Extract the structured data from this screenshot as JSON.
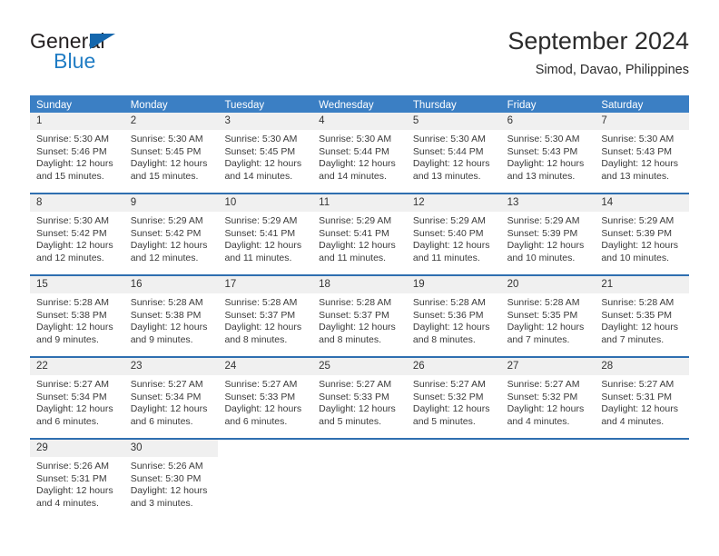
{
  "brand": {
    "line1": "General",
    "line2": "Blue",
    "flag_icon": "triangle-flag-icon",
    "accent_color": "#1f7cc4"
  },
  "header": {
    "title": "September 2024",
    "subtitle": "Simod, Davao, Philippines"
  },
  "theme": {
    "header_bar_color": "#3b7fc4",
    "row_divider_color": "#2f6fb0",
    "day_number_band_color": "#f0f0f0",
    "text_color": "#3a3a3a"
  },
  "weekdays": [
    "Sunday",
    "Monday",
    "Tuesday",
    "Wednesday",
    "Thursday",
    "Friday",
    "Saturday"
  ],
  "weeks": [
    [
      {
        "day": "1",
        "sunrise": "Sunrise: 5:30 AM",
        "sunset": "Sunset: 5:46 PM",
        "daylight": "Daylight: 12 hours and 15 minutes."
      },
      {
        "day": "2",
        "sunrise": "Sunrise: 5:30 AM",
        "sunset": "Sunset: 5:45 PM",
        "daylight": "Daylight: 12 hours and 15 minutes."
      },
      {
        "day": "3",
        "sunrise": "Sunrise: 5:30 AM",
        "sunset": "Sunset: 5:45 PM",
        "daylight": "Daylight: 12 hours and 14 minutes."
      },
      {
        "day": "4",
        "sunrise": "Sunrise: 5:30 AM",
        "sunset": "Sunset: 5:44 PM",
        "daylight": "Daylight: 12 hours and 14 minutes."
      },
      {
        "day": "5",
        "sunrise": "Sunrise: 5:30 AM",
        "sunset": "Sunset: 5:44 PM",
        "daylight": "Daylight: 12 hours and 13 minutes."
      },
      {
        "day": "6",
        "sunrise": "Sunrise: 5:30 AM",
        "sunset": "Sunset: 5:43 PM",
        "daylight": "Daylight: 12 hours and 13 minutes."
      },
      {
        "day": "7",
        "sunrise": "Sunrise: 5:30 AM",
        "sunset": "Sunset: 5:43 PM",
        "daylight": "Daylight: 12 hours and 13 minutes."
      }
    ],
    [
      {
        "day": "8",
        "sunrise": "Sunrise: 5:30 AM",
        "sunset": "Sunset: 5:42 PM",
        "daylight": "Daylight: 12 hours and 12 minutes."
      },
      {
        "day": "9",
        "sunrise": "Sunrise: 5:29 AM",
        "sunset": "Sunset: 5:42 PM",
        "daylight": "Daylight: 12 hours and 12 minutes."
      },
      {
        "day": "10",
        "sunrise": "Sunrise: 5:29 AM",
        "sunset": "Sunset: 5:41 PM",
        "daylight": "Daylight: 12 hours and 11 minutes."
      },
      {
        "day": "11",
        "sunrise": "Sunrise: 5:29 AM",
        "sunset": "Sunset: 5:41 PM",
        "daylight": "Daylight: 12 hours and 11 minutes."
      },
      {
        "day": "12",
        "sunrise": "Sunrise: 5:29 AM",
        "sunset": "Sunset: 5:40 PM",
        "daylight": "Daylight: 12 hours and 11 minutes."
      },
      {
        "day": "13",
        "sunrise": "Sunrise: 5:29 AM",
        "sunset": "Sunset: 5:39 PM",
        "daylight": "Daylight: 12 hours and 10 minutes."
      },
      {
        "day": "14",
        "sunrise": "Sunrise: 5:29 AM",
        "sunset": "Sunset: 5:39 PM",
        "daylight": "Daylight: 12 hours and 10 minutes."
      }
    ],
    [
      {
        "day": "15",
        "sunrise": "Sunrise: 5:28 AM",
        "sunset": "Sunset: 5:38 PM",
        "daylight": "Daylight: 12 hours and 9 minutes."
      },
      {
        "day": "16",
        "sunrise": "Sunrise: 5:28 AM",
        "sunset": "Sunset: 5:38 PM",
        "daylight": "Daylight: 12 hours and 9 minutes."
      },
      {
        "day": "17",
        "sunrise": "Sunrise: 5:28 AM",
        "sunset": "Sunset: 5:37 PM",
        "daylight": "Daylight: 12 hours and 8 minutes."
      },
      {
        "day": "18",
        "sunrise": "Sunrise: 5:28 AM",
        "sunset": "Sunset: 5:37 PM",
        "daylight": "Daylight: 12 hours and 8 minutes."
      },
      {
        "day": "19",
        "sunrise": "Sunrise: 5:28 AM",
        "sunset": "Sunset: 5:36 PM",
        "daylight": "Daylight: 12 hours and 8 minutes."
      },
      {
        "day": "20",
        "sunrise": "Sunrise: 5:28 AM",
        "sunset": "Sunset: 5:35 PM",
        "daylight": "Daylight: 12 hours and 7 minutes."
      },
      {
        "day": "21",
        "sunrise": "Sunrise: 5:28 AM",
        "sunset": "Sunset: 5:35 PM",
        "daylight": "Daylight: 12 hours and 7 minutes."
      }
    ],
    [
      {
        "day": "22",
        "sunrise": "Sunrise: 5:27 AM",
        "sunset": "Sunset: 5:34 PM",
        "daylight": "Daylight: 12 hours and 6 minutes."
      },
      {
        "day": "23",
        "sunrise": "Sunrise: 5:27 AM",
        "sunset": "Sunset: 5:34 PM",
        "daylight": "Daylight: 12 hours and 6 minutes."
      },
      {
        "day": "24",
        "sunrise": "Sunrise: 5:27 AM",
        "sunset": "Sunset: 5:33 PM",
        "daylight": "Daylight: 12 hours and 6 minutes."
      },
      {
        "day": "25",
        "sunrise": "Sunrise: 5:27 AM",
        "sunset": "Sunset: 5:33 PM",
        "daylight": "Daylight: 12 hours and 5 minutes."
      },
      {
        "day": "26",
        "sunrise": "Sunrise: 5:27 AM",
        "sunset": "Sunset: 5:32 PM",
        "daylight": "Daylight: 12 hours and 5 minutes."
      },
      {
        "day": "27",
        "sunrise": "Sunrise: 5:27 AM",
        "sunset": "Sunset: 5:32 PM",
        "daylight": "Daylight: 12 hours and 4 minutes."
      },
      {
        "day": "28",
        "sunrise": "Sunrise: 5:27 AM",
        "sunset": "Sunset: 5:31 PM",
        "daylight": "Daylight: 12 hours and 4 minutes."
      }
    ],
    [
      {
        "day": "29",
        "sunrise": "Sunrise: 5:26 AM",
        "sunset": "Sunset: 5:31 PM",
        "daylight": "Daylight: 12 hours and 4 minutes."
      },
      {
        "day": "30",
        "sunrise": "Sunrise: 5:26 AM",
        "sunset": "Sunset: 5:30 PM",
        "daylight": "Daylight: 12 hours and 3 minutes."
      },
      {
        "day": "",
        "sunrise": "",
        "sunset": "",
        "daylight": ""
      },
      {
        "day": "",
        "sunrise": "",
        "sunset": "",
        "daylight": ""
      },
      {
        "day": "",
        "sunrise": "",
        "sunset": "",
        "daylight": ""
      },
      {
        "day": "",
        "sunrise": "",
        "sunset": "",
        "daylight": ""
      },
      {
        "day": "",
        "sunrise": "",
        "sunset": "",
        "daylight": ""
      }
    ]
  ]
}
